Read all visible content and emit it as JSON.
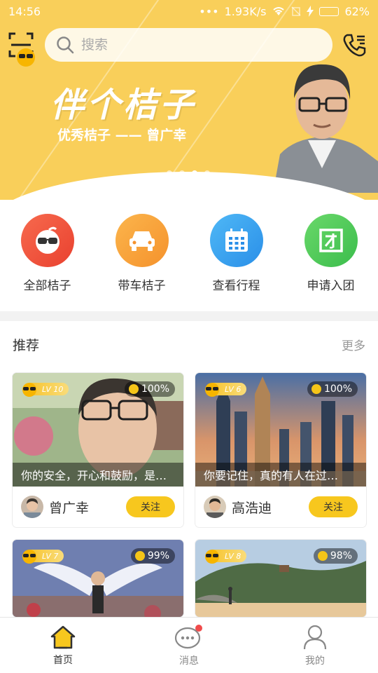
{
  "status_bar": {
    "time": "14:56",
    "network_speed": "1.93K/s",
    "battery_pct": "62%",
    "battery_level": 0.62
  },
  "banner": {
    "headline": "伴个桔子",
    "subline": "优秀桔子 —— 曾广幸",
    "dots_count": 4,
    "active_dot": 3
  },
  "search": {
    "placeholder": "搜索"
  },
  "actions": [
    {
      "label": "全部桔子",
      "icon": "orange-glasses-icon",
      "color": "#f0553e"
    },
    {
      "label": "带车桔子",
      "icon": "car-icon",
      "color": "#f7a63a"
    },
    {
      "label": "查看行程",
      "icon": "calendar-icon",
      "color": "#36a8f2"
    },
    {
      "label": "申请入团",
      "icon": "group-icon",
      "color": "#52c95a"
    }
  ],
  "recommend": {
    "title": "推荐",
    "more": "更多",
    "cards": [
      {
        "level": "LV 10",
        "percent": "100%",
        "quote": "你的安全，开心和鼓励，是…",
        "name": "曾广幸",
        "follow": "关注"
      },
      {
        "level": "LV 6",
        "percent": "100%",
        "quote": "你要记住，真的有人在过…",
        "name": "高浩迪",
        "follow": "关注"
      },
      {
        "level": "LV 7",
        "percent": "99%"
      },
      {
        "level": "LV 8",
        "percent": "98%"
      }
    ]
  },
  "tabbar": {
    "items": [
      {
        "label": "首页",
        "icon": "home-icon",
        "active": true
      },
      {
        "label": "消息",
        "icon": "message-icon",
        "active": false,
        "badge": true
      },
      {
        "label": "我的",
        "icon": "profile-icon",
        "active": false
      }
    ]
  },
  "colors": {
    "brand": "#f9cf5a",
    "accent": "#f7c71e",
    "badge": "#f04b4b"
  }
}
